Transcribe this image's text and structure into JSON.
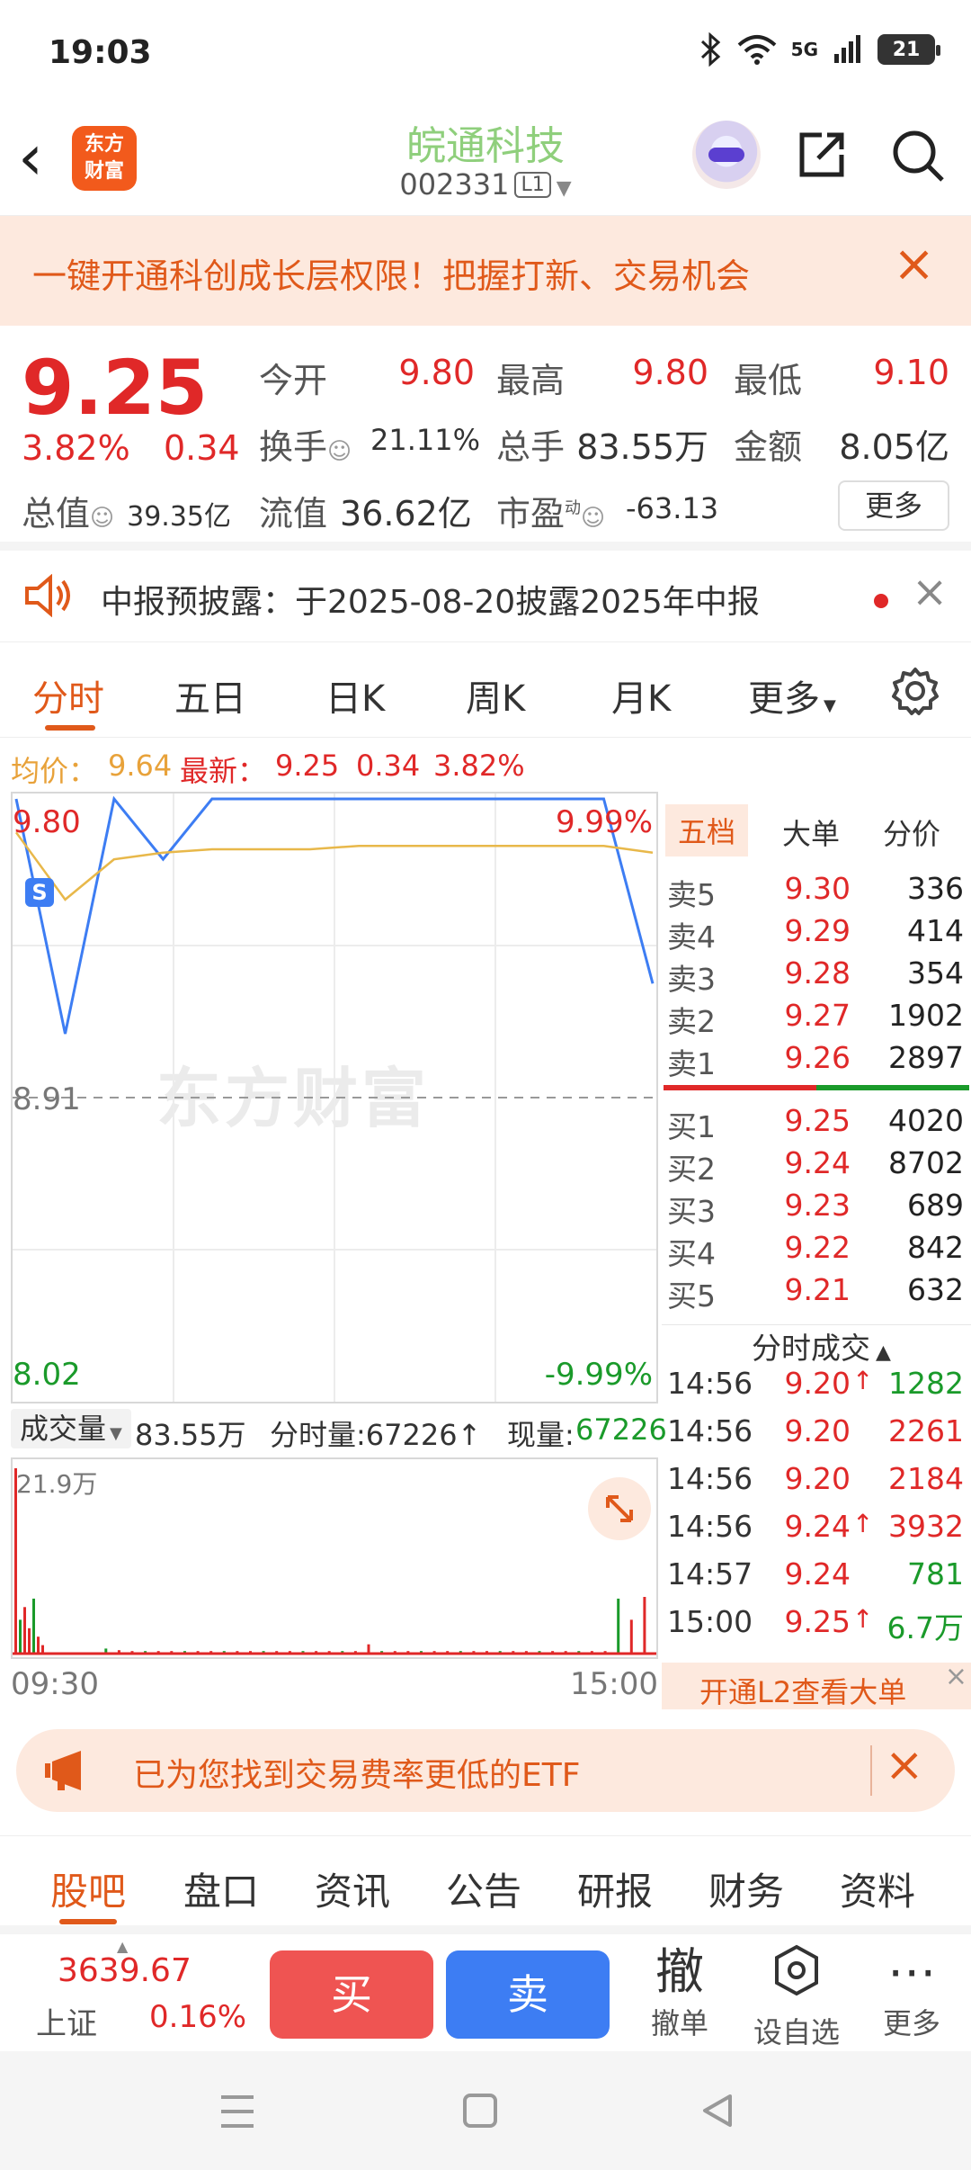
{
  "status_bar": {
    "time": "19:03",
    "network": "5G",
    "battery": "21"
  },
  "header": {
    "logo_line1": "东方",
    "logo_line2": "财富",
    "stock_name": "皖通科技",
    "stock_code": "002331",
    "level": "L1"
  },
  "promo_banner": {
    "text": "一键开通科创成长层权限！把握打新、交易机会"
  },
  "quote": {
    "price": "9.25",
    "change_pct": "3.82%",
    "change": "0.34",
    "open_label": "今开",
    "open": "9.80",
    "high_label": "最高",
    "high": "9.80",
    "low_label": "最低",
    "low": "9.10",
    "turnover_label": "换手",
    "turnover": "21.11%",
    "volume_label": "总手",
    "volume": "83.55万",
    "amount_label": "金额",
    "amount": "8.05亿",
    "mktcap_label": "总值",
    "mktcap": "39.35亿",
    "float_label": "流值",
    "float_cap": "36.62亿",
    "pe_label": "市盈",
    "pe_sup": "动",
    "pe": "-63.13",
    "more_label": "更多"
  },
  "notice": {
    "text": "中报预披露：于2025-08-20披露2025年中报"
  },
  "chart_tabs": [
    "分时",
    "五日",
    "日K",
    "周K",
    "月K",
    "更多"
  ],
  "avg_line": {
    "avg_label": "均价：",
    "avg": "9.64",
    "latest_label": "最新：",
    "latest": "9.25",
    "chg": "0.34",
    "pct": "3.82%"
  },
  "chart_data": {
    "type": "line",
    "ylim": [
      8.02,
      9.8
    ],
    "y_top_label": "9.80",
    "y_mid_label": "8.91",
    "y_bottom_label": "8.02",
    "pct_top_label": "9.99%",
    "pct_bottom_label": "-9.99%",
    "x_start": "09:30",
    "x_end": "15:00",
    "marker": "S",
    "watermark": "东方财富",
    "series": [
      {
        "values": [
          9.8,
          9.1,
          9.8,
          9.62,
          9.8,
          9.8,
          9.8,
          9.8,
          9.8,
          9.8,
          9.8,
          9.8,
          9.8,
          9.25
        ],
        "color": "#3d7df3"
      },
      {
        "values": [
          9.7,
          9.5,
          9.62,
          9.64,
          9.65,
          9.65,
          9.65,
          9.66,
          9.66,
          9.66,
          9.66,
          9.66,
          9.66,
          9.64
        ],
        "color": "#e8b84a"
      }
    ],
    "volume": {
      "max_label": "21.9万",
      "bars": [
        21.9,
        4,
        5.5,
        3,
        6.5,
        2,
        1,
        0.6,
        0.4,
        0.3,
        0.3,
        0.3,
        0.3,
        0.3,
        0.3,
        0.3,
        0.3,
        0.3,
        0.3,
        0.3,
        0.3,
        0.3,
        0.3,
        0.3,
        0.3,
        0.3,
        0.3,
        1.1,
        0.3,
        0.3,
        0.3,
        0.3,
        0.3,
        0.3,
        0.3,
        0.3,
        0.3,
        0.3,
        0.3,
        0.3,
        0.3,
        0.3,
        0.3,
        0.3,
        0.3,
        0.3,
        6.5,
        4,
        6.7
      ]
    }
  },
  "volume_bar": {
    "label": "成交量",
    "total": "83.55万",
    "tick_label": "分时量:67226↑",
    "now_label": "现量:",
    "now": "67226"
  },
  "book": {
    "tabs": [
      "五档",
      "大单",
      "分价"
    ],
    "asks": [
      {
        "label": "卖5",
        "price": "9.30",
        "qty": "336"
      },
      {
        "label": "卖4",
        "price": "9.29",
        "qty": "414"
      },
      {
        "label": "卖3",
        "price": "9.28",
        "qty": "354"
      },
      {
        "label": "卖2",
        "price": "9.27",
        "qty": "1902"
      },
      {
        "label": "卖1",
        "price": "9.26",
        "qty": "2897"
      }
    ],
    "bids": [
      {
        "label": "买1",
        "price": "9.25",
        "qty": "4020"
      },
      {
        "label": "买2",
        "price": "9.24",
        "qty": "8702"
      },
      {
        "label": "买3",
        "price": "9.23",
        "qty": "689"
      },
      {
        "label": "买4",
        "price": "9.22",
        "qty": "842"
      },
      {
        "label": "买5",
        "price": "9.21",
        "qty": "632"
      }
    ],
    "ticks_title": "分时成交",
    "ticks": [
      {
        "time": "14:56",
        "price": "9.20",
        "arrow": "↑",
        "qty": "1282",
        "qty_color": "green"
      },
      {
        "time": "14:56",
        "price": "9.20",
        "arrow": "",
        "qty": "2261",
        "qty_color": "red"
      },
      {
        "time": "14:56",
        "price": "9.20",
        "arrow": "",
        "qty": "2184",
        "qty_color": "red"
      },
      {
        "time": "14:56",
        "price": "9.24",
        "arrow": "↑",
        "qty": "3932",
        "qty_color": "red"
      },
      {
        "time": "14:57",
        "price": "9.24",
        "arrow": "",
        "qty": "781",
        "qty_color": "green"
      },
      {
        "time": "15:00",
        "price": "9.25",
        "arrow": "↑",
        "qty": "6.7万",
        "qty_color": "green"
      }
    ],
    "l2_label": "开通L2查看大单"
  },
  "etf_banner": {
    "text": "已为您找到交易费率更低的ETF"
  },
  "bottom_tabs": [
    "股吧",
    "盘口",
    "资讯",
    "公告",
    "研报",
    "财务",
    "资料"
  ],
  "action_bar": {
    "index_value": "3639.67",
    "index_name": "上证",
    "index_pct": "0.16%",
    "buy": "买",
    "sell": "卖",
    "cancel_icon": "撤",
    "cancel_label": "撤单",
    "watch_label": "设自选",
    "more_label": "更多"
  },
  "colors": {
    "up": "#e02828",
    "down": "#1a9a2a",
    "accent": "#e0591a",
    "price_line": "#3d7df3",
    "avg_line": "#e8b84a"
  }
}
